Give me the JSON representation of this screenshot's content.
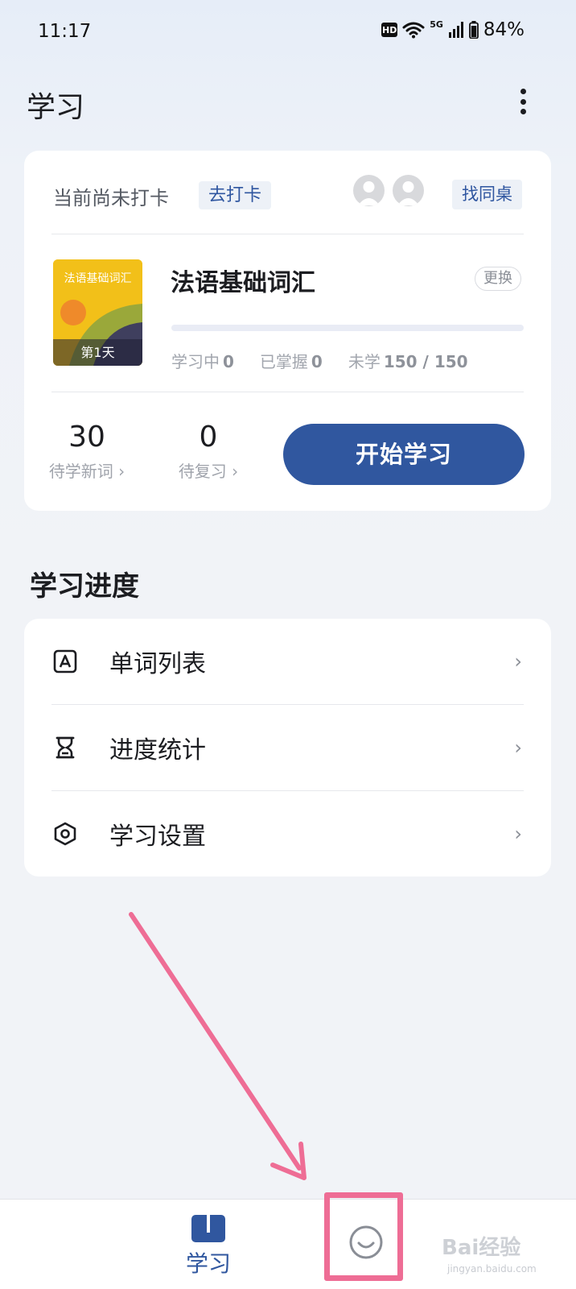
{
  "status_bar": {
    "time": "11:17",
    "hd": "HD",
    "network": "5G",
    "battery": "84%"
  },
  "header": {
    "title": "学习"
  },
  "checkin": {
    "status_text": "当前尚未打卡",
    "checkin_button": "去打卡",
    "find_deskmate_button": "找同桌"
  },
  "book": {
    "cover_title": "法语基础词汇",
    "cover_day": "第1天",
    "name": "法语基础词汇",
    "switch_button": "更换",
    "progress": 0,
    "stats": {
      "learning_label": "学习中",
      "learning_value": "0",
      "mastered_label": "已掌握",
      "mastered_value": "0",
      "unlearned_label": "未学",
      "unlearned_value": "150 / 150"
    }
  },
  "daily": {
    "new_words_count": "30",
    "new_words_label": "待学新词 ›",
    "review_count": "0",
    "review_label": "待复习 ›",
    "start_button": "开始学习"
  },
  "progress_section": {
    "title": "学习进度",
    "items": [
      {
        "label": "单词列表",
        "icon": "word-list-icon"
      },
      {
        "label": "进度统计",
        "icon": "hourglass-icon"
      },
      {
        "label": "学习设置",
        "icon": "settings-hexagon-icon"
      }
    ]
  },
  "bottom_nav": {
    "study_label": "学习",
    "me_icon": "smiley-icon"
  },
  "watermark": {
    "text": "Bai经验",
    "sub": "jingyan.baidu.com"
  },
  "colors": {
    "accent": "#30579f",
    "annotation": "#ee6d95",
    "cover": "#f2c019"
  }
}
